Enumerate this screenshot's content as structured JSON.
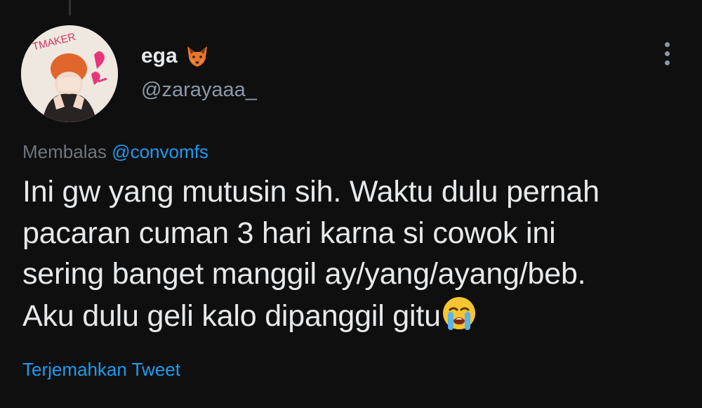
{
  "tweet": {
    "author": {
      "display_name": "ega",
      "name_emoji": "fox-face-icon",
      "handle": "@zarayaaa_",
      "avatar_text": "TMAKER"
    },
    "more_icon": "more-vertical-icon",
    "reply": {
      "prefix": "Membalas",
      "mention": "@convomfs"
    },
    "text_lines": [
      "Ini gw yang mutusin sih. Waktu dulu pernah",
      "pacaran cuman 3 hari karna si cowok ini",
      "sering banget manggil ay/yang/ayang/beb.",
      "Aku dulu geli kalo dipanggil gitu"
    ],
    "trailing_emoji": "loudly-crying-face-icon",
    "translate_label": "Terjemahkan Tweet"
  },
  "colors": {
    "background": "#0f0f10",
    "text": "#e7e9ea",
    "secondary": "#8b98a5",
    "link": "#1d9bf0"
  }
}
